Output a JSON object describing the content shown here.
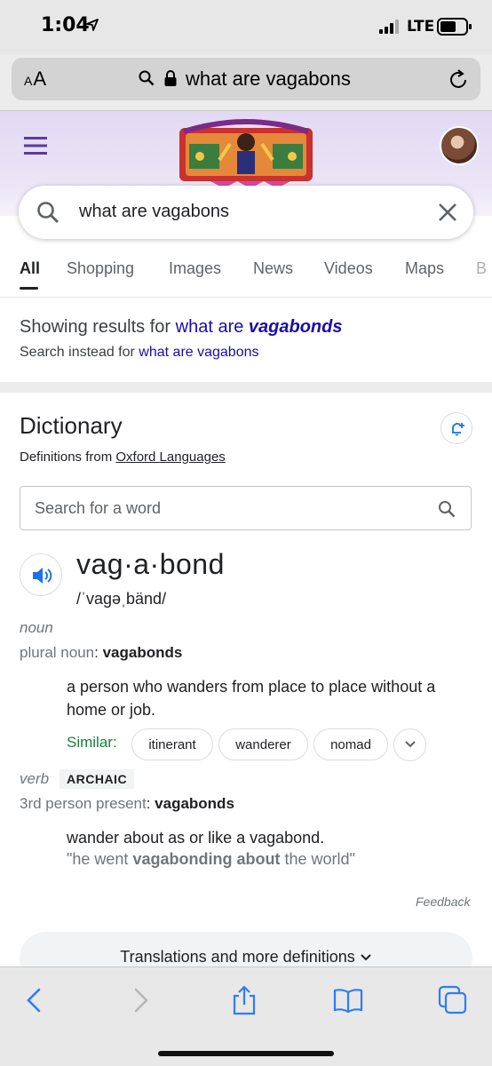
{
  "status": {
    "time": "1:04",
    "network": "LTE"
  },
  "address_bar": {
    "text_size_label": "AA",
    "url": "what are vagabons"
  },
  "search": {
    "query": "what are vagabons"
  },
  "tabs": [
    "All",
    "Shopping",
    "Images",
    "News",
    "Videos",
    "Maps",
    "B"
  ],
  "spelling": {
    "showing_prefix": "Showing results for ",
    "corrected_plain": "what are ",
    "corrected_bold": "vagabonds",
    "instead_prefix": "Search instead for ",
    "instead_link": "what are vagabons"
  },
  "dictionary": {
    "title": "Dictionary",
    "source_prefix": "Definitions from ",
    "source_link": "Oxford Languages",
    "search_placeholder": "Search for a word",
    "headword": "vag·a·bond",
    "phonetic": "/ˈvaɡəˌbänd/",
    "noun": {
      "pos": "noun",
      "plural_label": "plural noun",
      "plural_value": "vagabonds",
      "definition": "a person who wanders from place to place without a home or job.",
      "similar_label": "Similar:",
      "similar": [
        "itinerant",
        "wanderer",
        "nomad"
      ]
    },
    "verb": {
      "pos": "verb",
      "tag": "ARCHAIC",
      "third_label": "3rd person present",
      "third_value": "vagabonds",
      "definition": "wander about as or like a vagabond.",
      "example_pre": "\"he went ",
      "example_bold": "vagabonding about",
      "example_post": " the world\""
    },
    "feedback": "Feedback",
    "more_button": "Translations and more definitions"
  },
  "colors": {
    "link": "#1a0dab",
    "accent_purple": "#5b3c9c",
    "toolbar_blue": "#2f7cf6",
    "similar_green": "#188038"
  }
}
